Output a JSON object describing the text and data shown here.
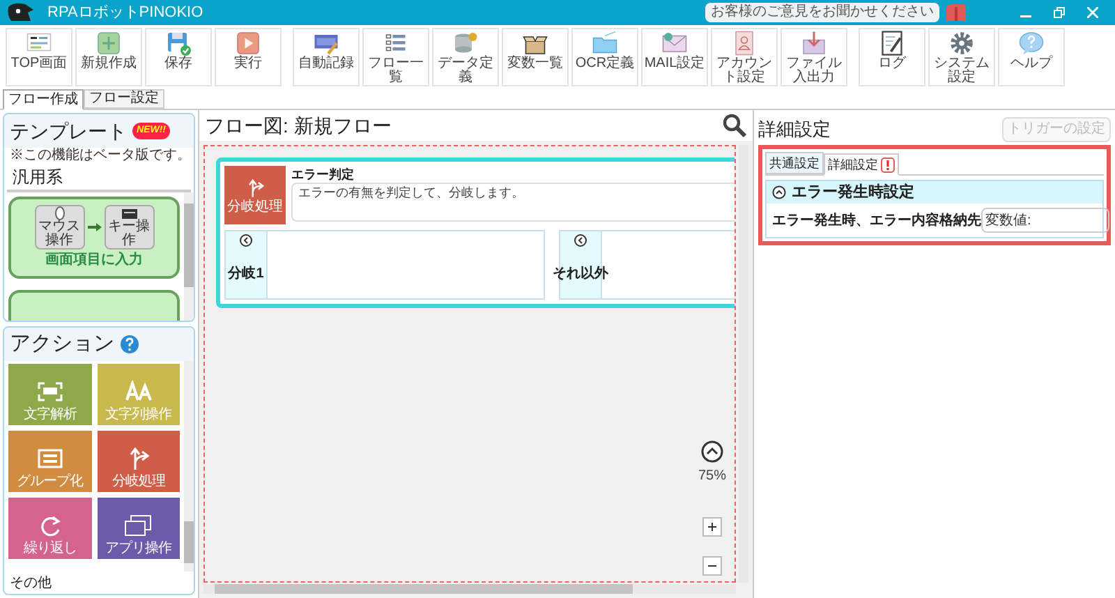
{
  "window": {
    "title": "RPAロボットPINOKIO",
    "feedback": "お客様のご意見をお聞かせください"
  },
  "toolbar": {
    "groups": [
      [
        {
          "label": "TOP画面"
        },
        {
          "label": "新規作成"
        },
        {
          "label": "保存"
        },
        {
          "label": "実行"
        }
      ],
      [
        {
          "label": "自動記録"
        },
        {
          "label": "フロー一覧"
        },
        {
          "label": "データ定義"
        },
        {
          "label": "変数一覧"
        },
        {
          "label": "OCR定義"
        },
        {
          "label": "MAIL設定"
        },
        {
          "label": "アカウント設定"
        },
        {
          "label": "ファイル入出力"
        }
      ],
      [
        {
          "label": "ログ"
        },
        {
          "label": "システム設定"
        },
        {
          "label": "ヘルプ"
        }
      ]
    ]
  },
  "tabs": [
    {
      "label": "フロー作成",
      "selected": true
    },
    {
      "label": "フロー設定",
      "selected": false
    }
  ],
  "template_panel": {
    "title": "テンプレート",
    "badge": "NEW!!",
    "note": "※この機能はベータ版です。",
    "category": "汎用系",
    "cards": [
      {
        "title": "画面項目に入力",
        "from": "マウス操作",
        "to": "キー操作"
      }
    ]
  },
  "action_panel": {
    "title": "アクション",
    "tiles": [
      {
        "label": "文字解析",
        "color": "#8fa84a"
      },
      {
        "label": "文字列操作",
        "color": "#c9b94c"
      },
      {
        "label": "グループ化",
        "color": "#d08c40"
      },
      {
        "label": "分岐処理",
        "color": "#cf5d47"
      },
      {
        "label": "繰り返し",
        "color": "#d4648e"
      },
      {
        "label": "アプリ操作",
        "color": "#6c5aaa"
      }
    ],
    "section": "その他"
  },
  "flow": {
    "title": "フロー図: 新規フロー",
    "node": {
      "icon_label": "分岐処理",
      "title": "エラー判定",
      "description": "エラーの有無を判定して、分岐します。",
      "branches": [
        {
          "label": "分岐1"
        },
        {
          "label": "それ以外"
        }
      ]
    },
    "zoom": "75%"
  },
  "details": {
    "title": "詳細設定",
    "trigger_button": {
      "label": "トリガーの設定",
      "disabled": true
    },
    "tabs": [
      {
        "label": "共通設定",
        "selected": false,
        "alert": false
      },
      {
        "label": "詳細設定",
        "selected": true,
        "alert": true
      }
    ],
    "section": {
      "title": "エラー発生時設定",
      "expanded": true
    },
    "fields": [
      {
        "label": "エラー発生時、エラー内容格納先",
        "value": "変数値:"
      }
    ]
  }
}
